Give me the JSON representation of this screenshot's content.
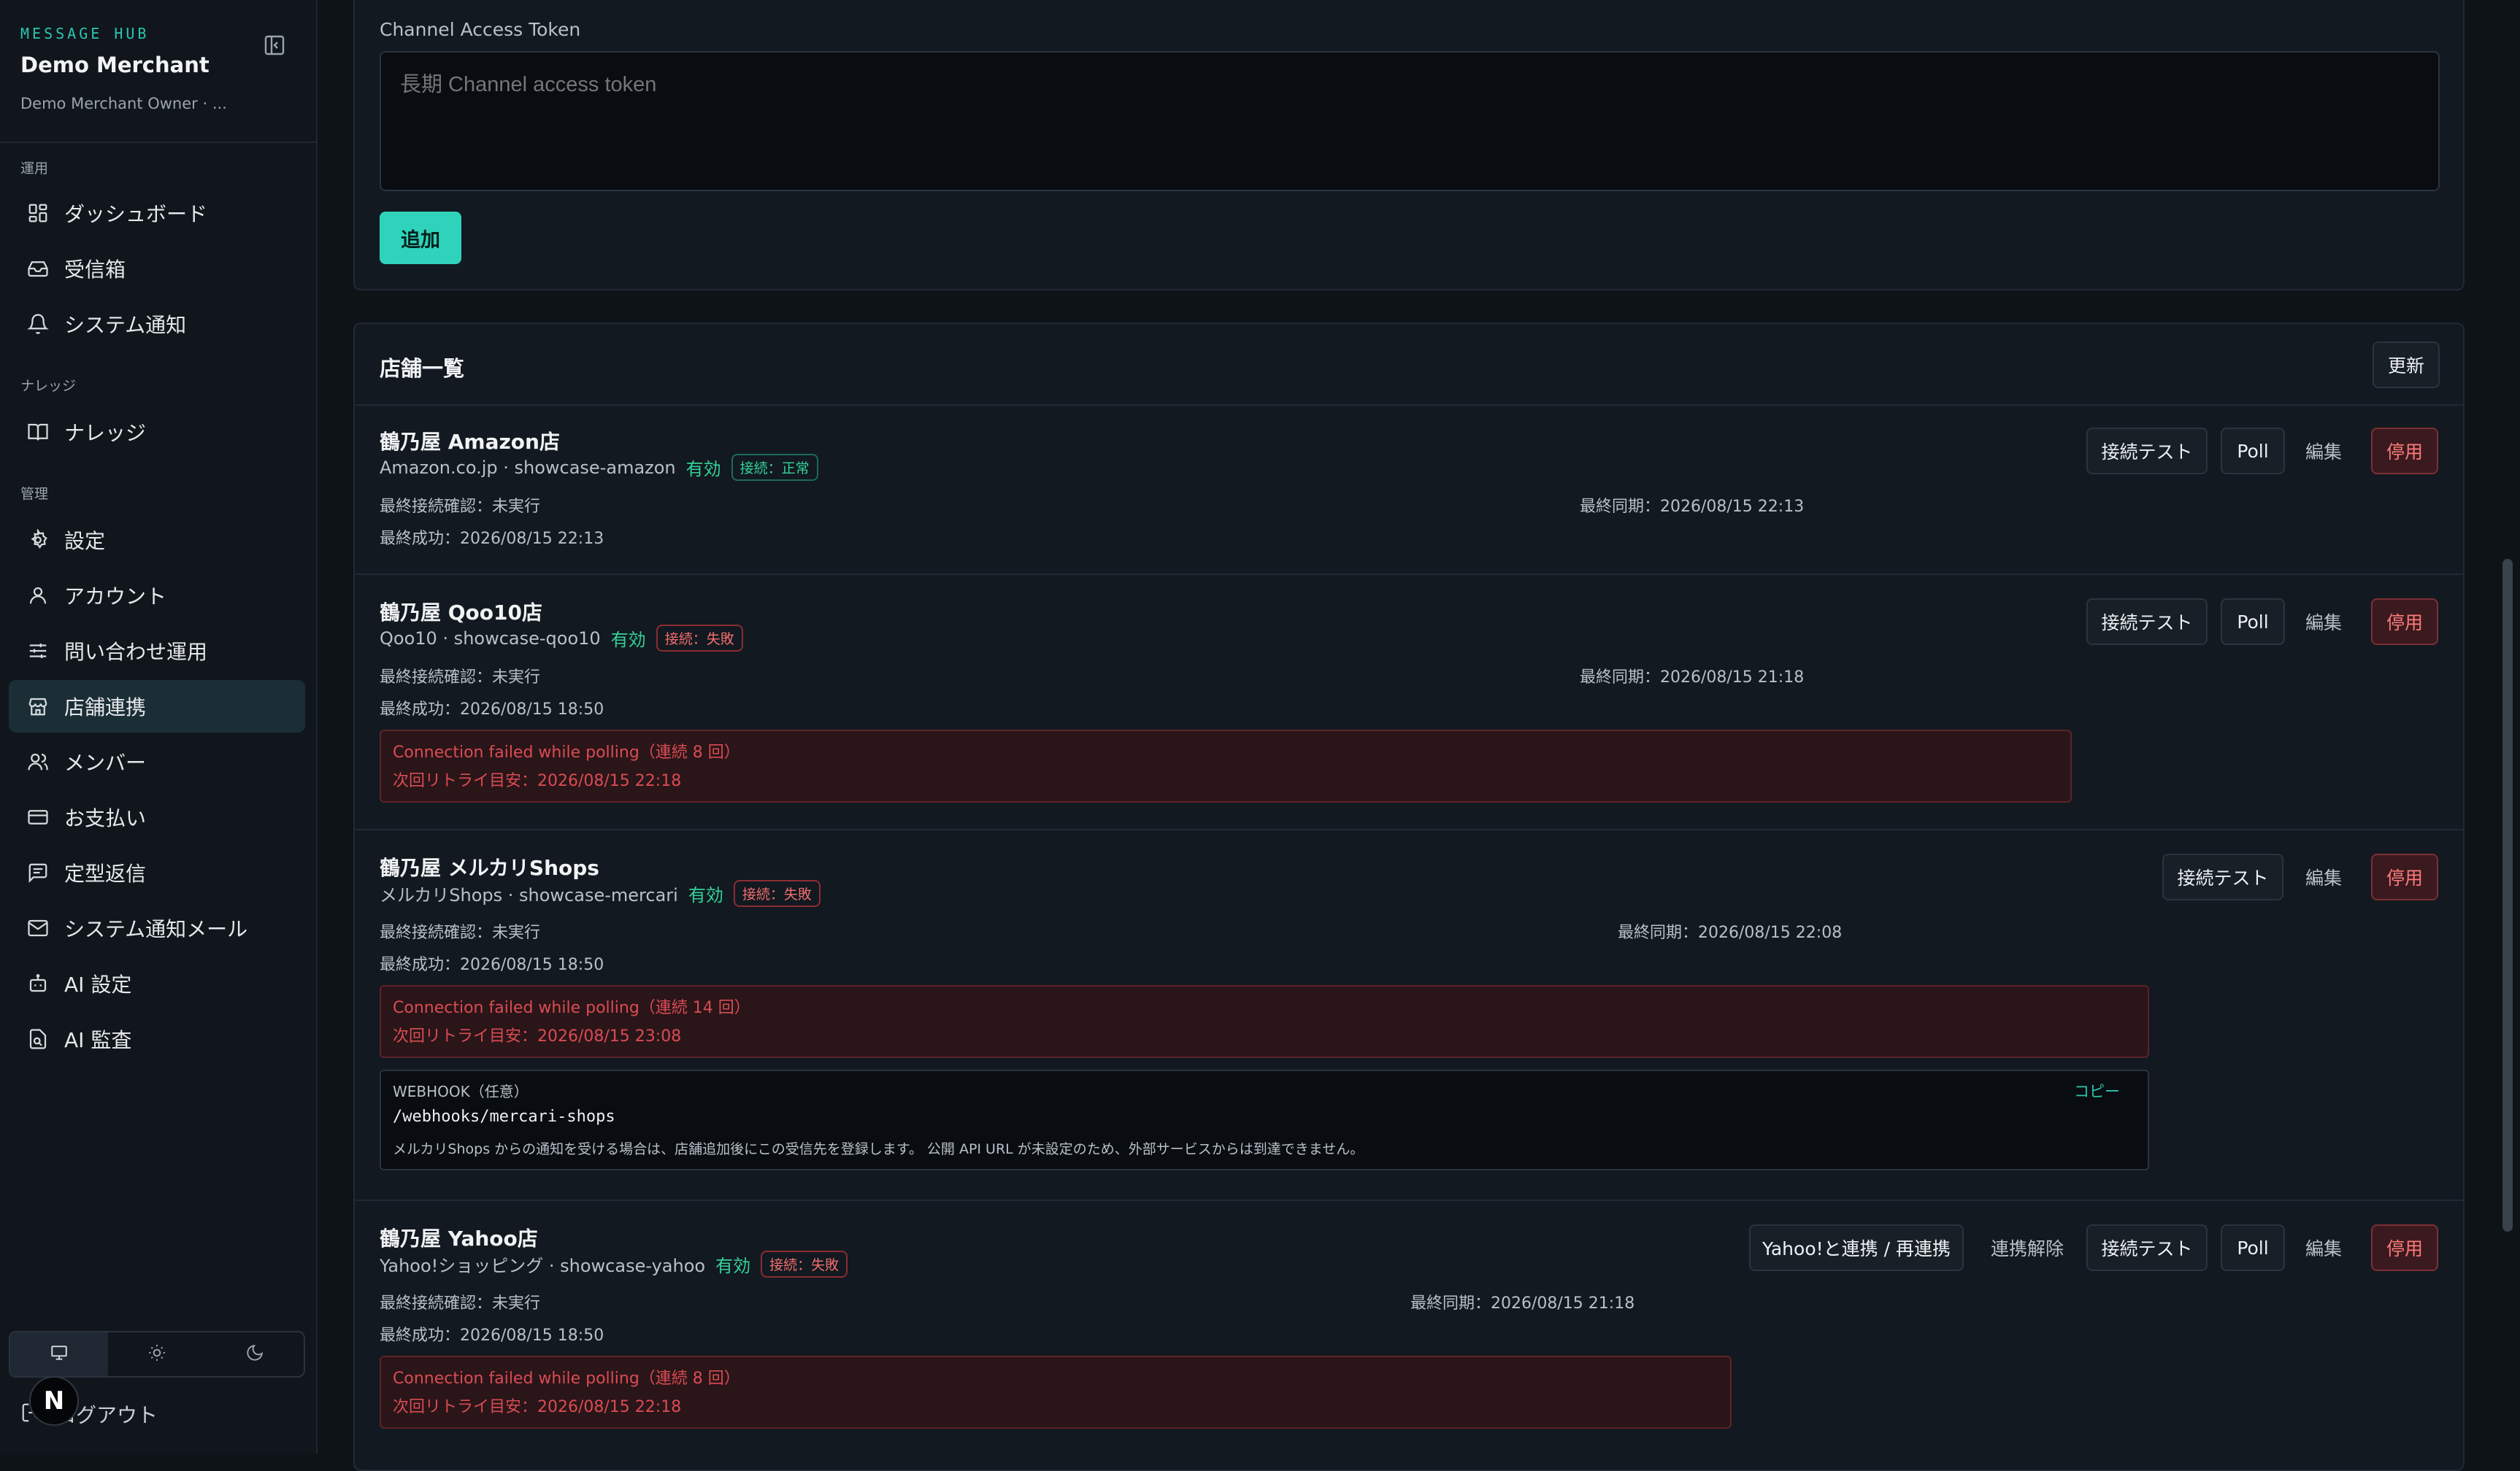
{
  "sidebar": {
    "eyebrow": "MESSAGE HUB",
    "title": "Demo Merchant",
    "subtitle": "Demo Merchant Owner · ...",
    "sections": {
      "ops": "運用",
      "knowledge": "ナレッジ",
      "admin": "管理"
    },
    "items": [
      {
        "label": "ダッシュボード",
        "icon": "dashboard-icon"
      },
      {
        "label": "受信箱",
        "icon": "inbox-icon"
      },
      {
        "label": "システム通知",
        "icon": "bell-icon"
      },
      {
        "label": "ナレッジ",
        "icon": "book-icon"
      },
      {
        "label": "設定",
        "icon": "gear-icon"
      },
      {
        "label": "アカウント",
        "icon": "user-icon"
      },
      {
        "label": "問い合わせ運用",
        "icon": "sliders-icon"
      },
      {
        "label": "店舗連携",
        "icon": "store-icon"
      },
      {
        "label": "メンバー",
        "icon": "users-icon"
      },
      {
        "label": "お支払い",
        "icon": "credit-card-icon"
      },
      {
        "label": "定型返信",
        "icon": "template-icon"
      },
      {
        "label": "システム通知メール",
        "icon": "mail-icon"
      },
      {
        "label": "AI 設定",
        "icon": "bot-icon"
      },
      {
        "label": "AI 監査",
        "icon": "audit-icon"
      }
    ],
    "active_item": "店舗連携",
    "logout": "ログアウト",
    "avatar_letter": "N"
  },
  "token_form": {
    "label": "Channel Access Token",
    "placeholder": "長期 Channel access token",
    "add_button": "追加"
  },
  "store_list": {
    "title": "店舗一覧",
    "refresh": "更新",
    "stores": [
      {
        "name": "鶴乃屋 Amazon店",
        "meta": "Amazon.co.jp · showcase-amazon",
        "status": "有効",
        "conn": "接続：正常",
        "last_check": "最終接続確認：未実行",
        "last_sync": "最終同期：2026/08/15 22:13",
        "last_success": "最終成功：2026/08/15 22:13",
        "actions": {
          "test": "接続テスト",
          "poll": "Poll",
          "edit": "編集",
          "disable": "停用"
        }
      },
      {
        "name": "鶴乃屋 Qoo10店",
        "meta": "Qoo10 · showcase-qoo10",
        "status": "有効",
        "conn": "接続：失敗",
        "last_check": "最終接続確認：未実行",
        "last_sync": "最終同期：2026/08/15 21:18",
        "last_success": "最終成功：2026/08/15 18:50",
        "error": "Connection failed while polling（連続 8 回）",
        "retry": "次回リトライ目安：2026/08/15 22:18",
        "actions": {
          "test": "接続テスト",
          "poll": "Poll",
          "edit": "編集",
          "disable": "停用"
        }
      },
      {
        "name": "鶴乃屋 メルカリShops",
        "meta": "メルカリShops · showcase-mercari",
        "status": "有効",
        "conn": "接続：失敗",
        "last_check": "最終接続確認：未実行",
        "last_sync": "最終同期：2026/08/15 22:08",
        "last_success": "最終成功：2026/08/15 18:50",
        "error": "Connection failed while polling（連続 14 回）",
        "retry": "次回リトライ目安：2026/08/15 23:08",
        "webhook": {
          "label": "WEBHOOK（任意）",
          "path": "/webhooks/mercari-shops",
          "note": "メルカリShops からの通知を受ける場合は、店舗追加後にこの受信先を登録します。 公開 API URL が未設定のため、外部サービスからは到達できません。",
          "copy": "コピー"
        },
        "actions": {
          "test": "接続テスト",
          "edit": "編集",
          "disable": "停用"
        }
      },
      {
        "name": "鶴乃屋 Yahoo店",
        "meta": "Yahoo!ショッピング · showcase-yahoo",
        "status": "有効",
        "conn": "接続：失敗",
        "last_check": "最終接続確認：未実行",
        "last_sync": "最終同期：2026/08/15 21:18",
        "last_success": "最終成功：2026/08/15 18:50",
        "error": "Connection failed while polling（連続 8 回）",
        "retry": "次回リトライ目安：2026/08/15 22:18",
        "actions": {
          "link": "Yahoo!と連携 / 再連携",
          "unlink": "連携解除",
          "test": "接続テスト",
          "poll": "Poll",
          "edit": "編集",
          "disable": "停用"
        }
      }
    ]
  }
}
